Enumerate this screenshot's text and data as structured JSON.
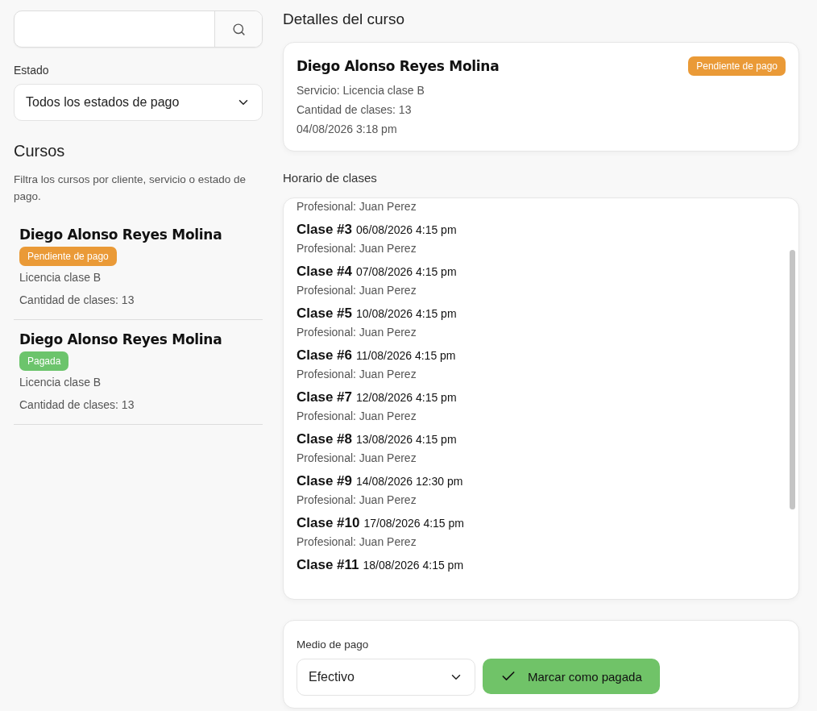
{
  "status_filter": {
    "label": "Estado",
    "value": "Todos los estados de pago"
  },
  "courses": {
    "title": "Cursos",
    "description": "Filtra los cursos por cliente, servicio o estado de pago.",
    "items": [
      {
        "name": "Diego Alonso Reyes Molina",
        "status": "Pendiente de pago",
        "color": "#ea9a37",
        "service": "Licencia clase B",
        "classes": "Cantidad de clases: 13"
      },
      {
        "name": "Diego Alonso Reyes Molina",
        "status": "Pagada",
        "color": "#6cc46c",
        "service": "Licencia clase B",
        "classes": "Cantidad de clases: 13"
      }
    ]
  },
  "details": {
    "title": "Detalles del curso",
    "name": "Diego Alonso Reyes Molina",
    "status": "Pendiente de pago",
    "color": "#ea9a37",
    "service": "Servicio: Licencia clase B",
    "classes": "Cantidad de clases: 13",
    "date": "04/08/2026 3:18 pm"
  },
  "schedule": {
    "title": "Horario de clases",
    "top_partial": "Profesional: Juan Perez",
    "items": [
      {
        "label": "Clase #3",
        "date": "06/08/2026 4:15 pm",
        "professional": "Profesional: Juan Perez"
      },
      {
        "label": "Clase #4",
        "date": "07/08/2026 4:15 pm",
        "professional": "Profesional: Juan Perez"
      },
      {
        "label": "Clase #5",
        "date": "10/08/2026 4:15 pm",
        "professional": "Profesional: Juan Perez"
      },
      {
        "label": "Clase #6",
        "date": "11/08/2026 4:15 pm",
        "professional": "Profesional: Juan Perez"
      },
      {
        "label": "Clase #7",
        "date": "12/08/2026 4:15 pm",
        "professional": "Profesional: Juan Perez"
      },
      {
        "label": "Clase #8",
        "date": "13/08/2026 4:15 pm",
        "professional": "Profesional: Juan Perez"
      },
      {
        "label": "Clase #9",
        "date": "14/08/2026 12:30 pm",
        "professional": "Profesional: Juan Perez"
      },
      {
        "label": "Clase #10",
        "date": "17/08/2026 4:15 pm",
        "professional": "Profesional: Juan Perez"
      },
      {
        "label": "Clase #11",
        "date": "18/08/2026 4:15 pm"
      }
    ]
  },
  "payment": {
    "label": "Medio de pago",
    "method": "Efectivo",
    "button": "Marcar como pagada"
  }
}
